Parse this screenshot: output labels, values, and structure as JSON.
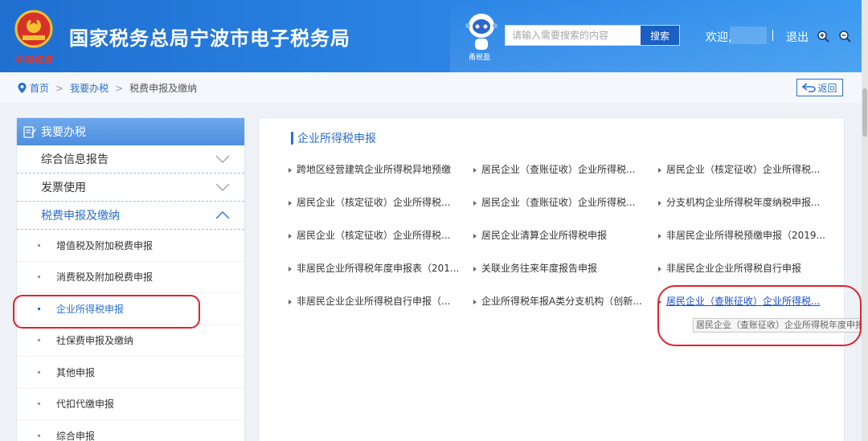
{
  "header": {
    "emblem_caption": "中国税务",
    "title": "国家税务总局宁波市电子税务局",
    "robot_label": "甬税盈",
    "search_placeholder": "请输入需要搜索的内容",
    "search_button": "搜索",
    "welcome": "欢迎,",
    "logout": "退出"
  },
  "breadcrumb": {
    "home": "首页",
    "level1": "我要办税",
    "current": "税费申报及缴纳",
    "back": "返回"
  },
  "sidebar": {
    "title": "我要办税",
    "menus": [
      {
        "label": "综合信息报告"
      },
      {
        "label": "发票使用"
      },
      {
        "label": "税费申报及缴纳"
      }
    ],
    "subitems": [
      {
        "label": "增值税及附加税费申报"
      },
      {
        "label": "消费税及附加税费申报"
      },
      {
        "label": "企业所得税申报"
      },
      {
        "label": "社保费申报及缴纳"
      },
      {
        "label": "其他申报"
      },
      {
        "label": "代扣代缴申报"
      },
      {
        "label": "综合申报"
      }
    ]
  },
  "main": {
    "section_title": "企业所得税申报",
    "links": [
      "跨地区经营建筑企业所得税异地预缴",
      "居民企业（查账征收）企业所得税...",
      "居民企业（核定征收）企业所得税...",
      "居民企业（核定征收）企业所得税...",
      "居民企业（查账征收）企业所得税...",
      "分支机构企业所得税年度纳税申报...",
      "居民企业（核定征收）企业所得税...",
      "居民企业清算企业所得税申报",
      "非居民企业所得税预缴申报（2019...",
      "非居民企业所得税年度申报表（201...",
      "关联业务往来年度报告申报",
      "非居民企业企业所得税自行申报",
      "非居民企业企业所得税自行申报（...",
      "企业所得税年报A类分支机构（创新...",
      "居民企业（查账征收）企业所得税..."
    ],
    "tooltip": "居民企业（查账征收）企业所得税年度申报"
  },
  "colors": {
    "header_blue": "#2c86e6",
    "link_blue": "#2a6fcf",
    "annotation_red": "#e0232c"
  }
}
